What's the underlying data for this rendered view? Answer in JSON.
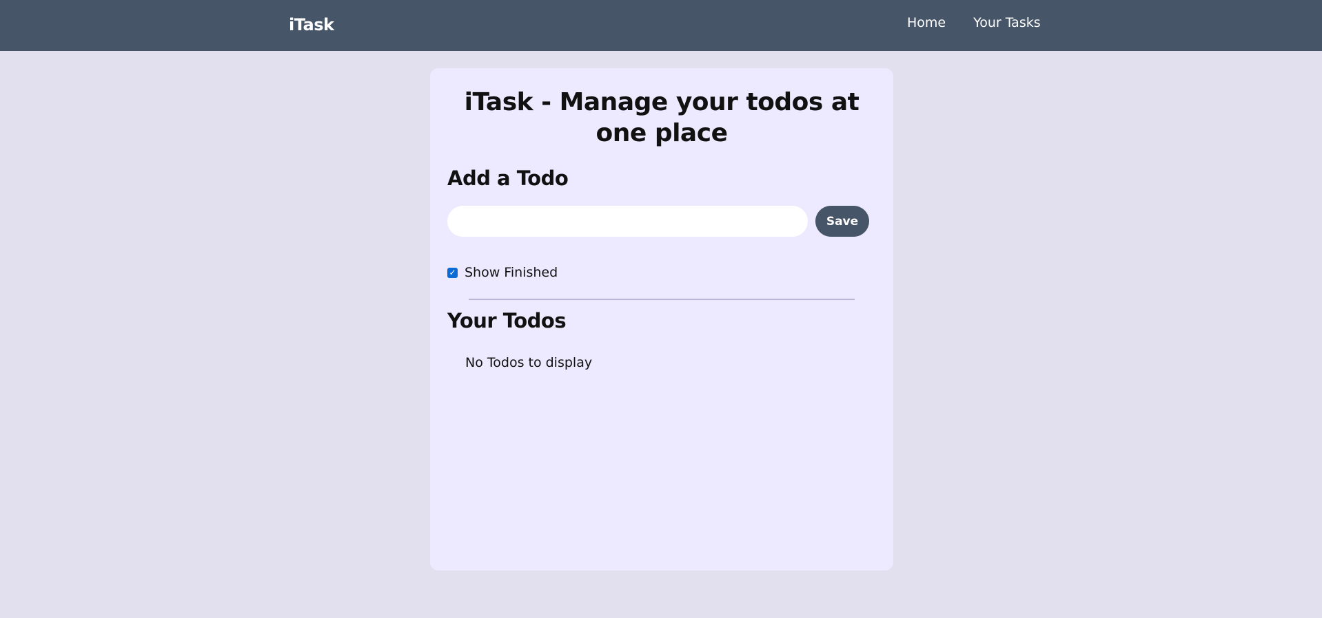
{
  "navbar": {
    "brand": "iTask",
    "links": [
      "Home",
      "Your Tasks"
    ],
    "bg_color": "#475569"
  },
  "main": {
    "title": "iTask - Manage your todos at one place",
    "add_section": {
      "title": "Add a Todo",
      "input_value": "",
      "input_placeholder": "",
      "save_label": "Save"
    },
    "show_finished": {
      "label": "Show Finished",
      "checked": true
    },
    "todos_section": {
      "title": "Your Todos",
      "empty_message": "No Todos to display"
    }
  },
  "colors": {
    "page_bg": "#e2e0ee",
    "card_bg": "#ede9fe",
    "accent": "#475569"
  }
}
